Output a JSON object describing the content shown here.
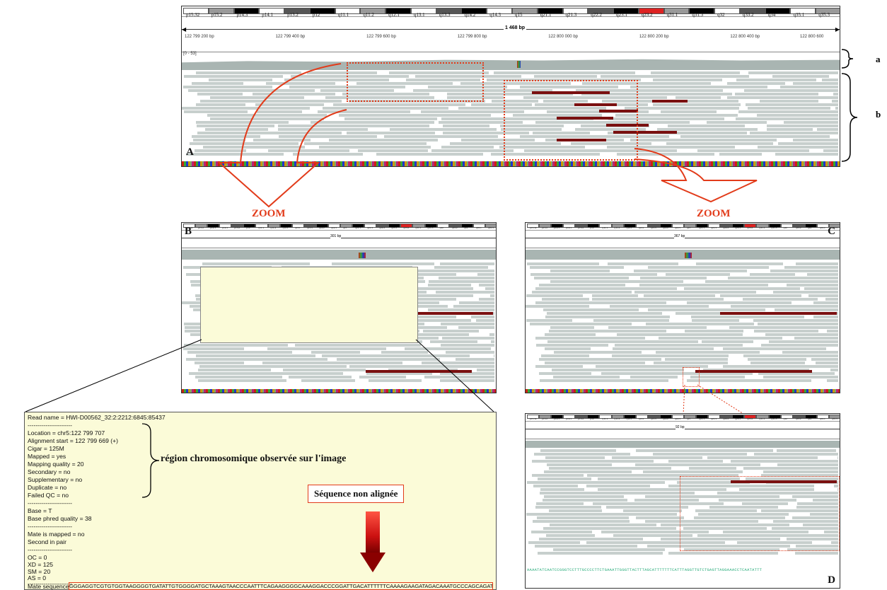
{
  "ideogram": {
    "bands": [
      "p15.32",
      "p15.2",
      "p14.3",
      "p14.1",
      "p13.2",
      "p12",
      "q11.1",
      "q11.2",
      "q12.1",
      "q13.1",
      "q13.3",
      "q14.2",
      "q14.3",
      "q15",
      "q21.1",
      "q21.3",
      "q22.2",
      "q23.1",
      "q23.2",
      "q31.1",
      "q31.3",
      "q32",
      "q33.2",
      "q34",
      "q35.1",
      "q35.3"
    ]
  },
  "ruler": {
    "span": "1 468 bp",
    "ticks": [
      "122 799 200 bp",
      "122 799 400 bp",
      "122 799 600 bp",
      "122 799 800 bp",
      "122 800 000 bp",
      "122 800 200 bp",
      "122 800 400 bp",
      "122 800 600"
    ]
  },
  "coverage_range": "[0 - 53]",
  "labels": {
    "A": "A",
    "B": "B",
    "C": "C",
    "D": "D",
    "a": "a",
    "b": "b",
    "zoom_left": "ZOOM",
    "zoom_right": "ZOOM"
  },
  "zoom_panel_B": {
    "span": "301 bp"
  },
  "zoom_panel_C": {
    "span": "367 bp"
  },
  "zoom_panel_D": {
    "span": "92 bp"
  },
  "read_info": {
    "read_name": "Read name = HWI-D00562_32:2:2212:6845:85437",
    "sep1": "----------------------",
    "location": "Location = chr5:122 799 707",
    "alignment_start": "Alignment start = 122 799 669 (+)",
    "cigar": "Cigar = 125M",
    "mapped": "Mapped = yes",
    "mapping_quality": "Mapping quality = 20",
    "secondary": "Secondary = no",
    "supplementary": "Supplementary = no",
    "duplicate": "Duplicate = no",
    "failed_qc": "Failed QC = no",
    "sep2": "----------------------",
    "base": "Base = T",
    "base_quality": "Base phred quality = 38",
    "sep3": "----------------------",
    "mate_mapped": "Mate is mapped = no",
    "second_in_pair": "Second in pair",
    "sep4": "----------------------",
    "oc": "OC = 0",
    "xd": "XD = 125",
    "sm": "SM = 20",
    "as": "AS = 0",
    "sep5": "----------------------",
    "mate_seq_label": "Mate sequence",
    "mate_seq": "GGGAGGTCGTGTGGTAAGGGGTGATATTGTGGGGATGCTAAAGTAACCCAATTTCAGAAGGGGCAAAGGACCCGGATTGACATTTTTTCAAAAGAAGATAGACAAATGCCCAGCAGATCTGTGAA"
  },
  "annotations": {
    "region": "région chromosomique observée sur l'image",
    "unaligned": "Séquence non alignée"
  },
  "panel_D_seq": "AAAATATCAATCCGGGTCCTTTGCCCCTTCTGAAATTGGGTTACTTTAGCATTTTTTTCATTTAGGTTGTCTGAGTTAGGAAACCTCAATATTT",
  "colors": {
    "accent": "#e23b1a",
    "read": "#c7cfcd",
    "coverage": "#a9b5b2",
    "dark_read": "#7a1010",
    "popup": "#fbfbd8"
  }
}
